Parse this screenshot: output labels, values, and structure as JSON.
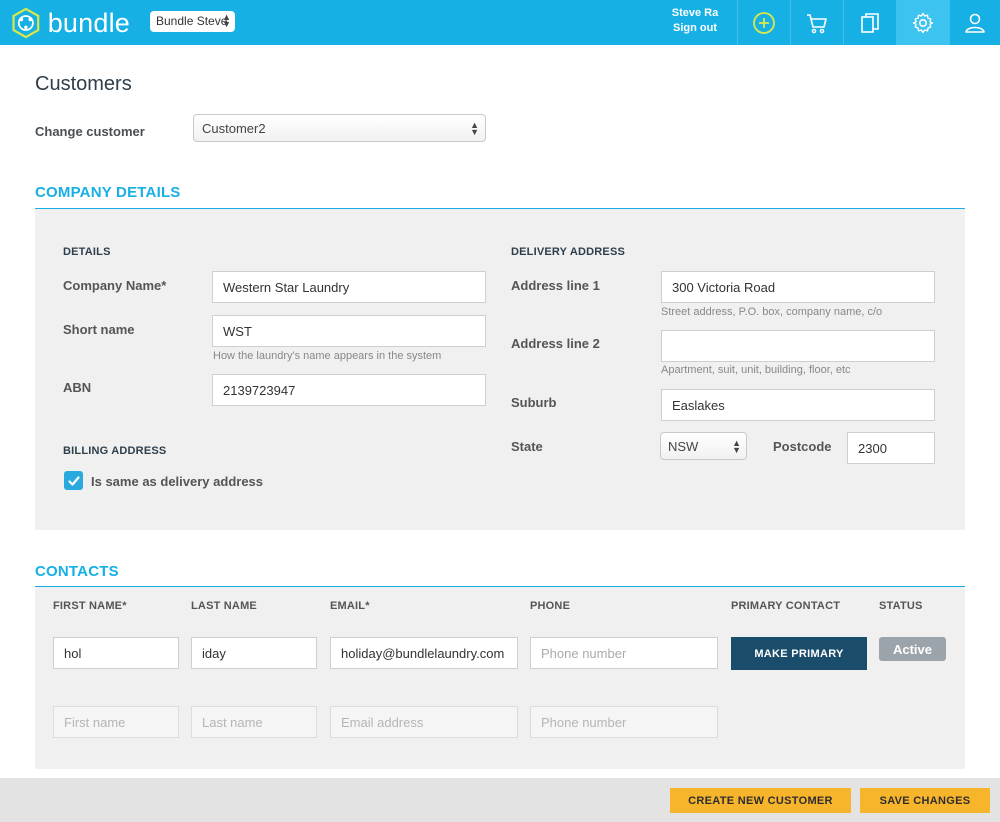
{
  "app": {
    "name": "bundle",
    "company_selector": "Bundle Steve",
    "user_name": "Steve Ra",
    "sign_out": "Sign out",
    "toolbar_icons": [
      "plus-circle-icon",
      "cart-icon",
      "documents-icon",
      "gear-icon",
      "user-icon"
    ],
    "colors": {
      "brand": "#16b0e4",
      "dark_button": "#1a4c6b",
      "yellow_button": "#f7b52b",
      "panel": "#f0f0f0"
    }
  },
  "page": {
    "title": "Customers",
    "change_customer_label": "Change customer",
    "change_customer_value": "Customer2"
  },
  "company": {
    "section_title": "COMPANY DETAILS",
    "details_heading": "DETAILS",
    "company_name_label": "Company Name*",
    "company_name_value": "Western Star Laundry",
    "short_name_label": "Short name",
    "short_name_value": "WST",
    "short_name_hint": "How the laundry's name appears in the system",
    "abn_label": "ABN",
    "abn_value": "2139723947",
    "billing_heading": "BILLING ADDRESS",
    "billing_same_label": "Is same as delivery address",
    "billing_same_checked": true
  },
  "delivery": {
    "heading": "DELIVERY ADDRESS",
    "address1_label": "Address line 1",
    "address1_value": "300 Victoria Road",
    "address1_hint": "Street address, P.O. box, company name, c/o",
    "address2_label": "Address line 2",
    "address2_value": "",
    "address2_hint": "Apartment, suit, unit, building, floor, etc",
    "suburb_label": "Suburb",
    "suburb_value": "Easlakes",
    "state_label": "State",
    "state_value": "NSW",
    "postcode_label": "Postcode",
    "postcode_value": "2300"
  },
  "contacts": {
    "section_title": "CONTACTS",
    "columns": [
      "FIRST NAME*",
      "LAST NAME",
      "EMAIL*",
      "PHONE",
      "PRIMARY CONTACT",
      "STATUS"
    ],
    "rows": [
      {
        "first_name": "hol",
        "last_name": "iday",
        "email": "holiday@bundlelaundry.com",
        "phone": "",
        "primary_action": "MAKE PRIMARY",
        "status": "Active"
      }
    ],
    "new_row_placeholders": {
      "first_name": "First name",
      "last_name": "Last name",
      "email": "Email address",
      "phone": "Phone number"
    },
    "phone_placeholder": "Phone number"
  },
  "footer": {
    "create_label": "CREATE NEW CUSTOMER",
    "save_label": "SAVE CHANGES"
  }
}
